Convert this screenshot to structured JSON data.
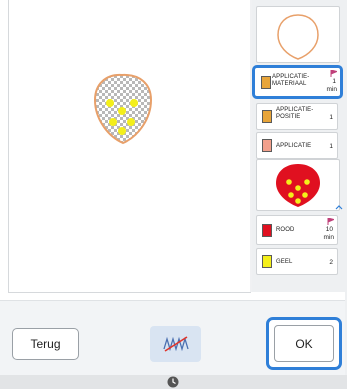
{
  "threads": [
    {
      "label": "APPLICATIE-\nMATERIAAL",
      "count": "1",
      "time": "min",
      "color": "#e8a53a",
      "has_flag": true,
      "selected": true
    },
    {
      "label": "APPLICATIE-\nPOSITIE",
      "count": "1",
      "time": "",
      "color": "#e8a53a",
      "has_flag": false,
      "selected": false
    },
    {
      "label": "APPLICATIE",
      "count": "1",
      "time": "",
      "color": "#f2a08c",
      "has_flag": false,
      "selected": false
    },
    {
      "label": "ROOD",
      "count": "10",
      "time": "min",
      "color": "#e01020",
      "has_flag": true,
      "selected": false
    },
    {
      "label": "GEEL",
      "count": "2",
      "time": "",
      "color": "#f4ef1a",
      "has_flag": false,
      "selected": false
    }
  ],
  "buttons": {
    "back_label": "Terug",
    "ok_label": "OK"
  },
  "icons": {
    "thread_cut": "thread-trim-icon",
    "clock": "clock-icon",
    "scroll": "chevron-up-icon",
    "flag": "flag-icon"
  },
  "colors": {
    "accent": "#2f7fd8",
    "outline": "#e8a06a",
    "strawberry": "#e01020",
    "seed": "#f4ef1a"
  }
}
